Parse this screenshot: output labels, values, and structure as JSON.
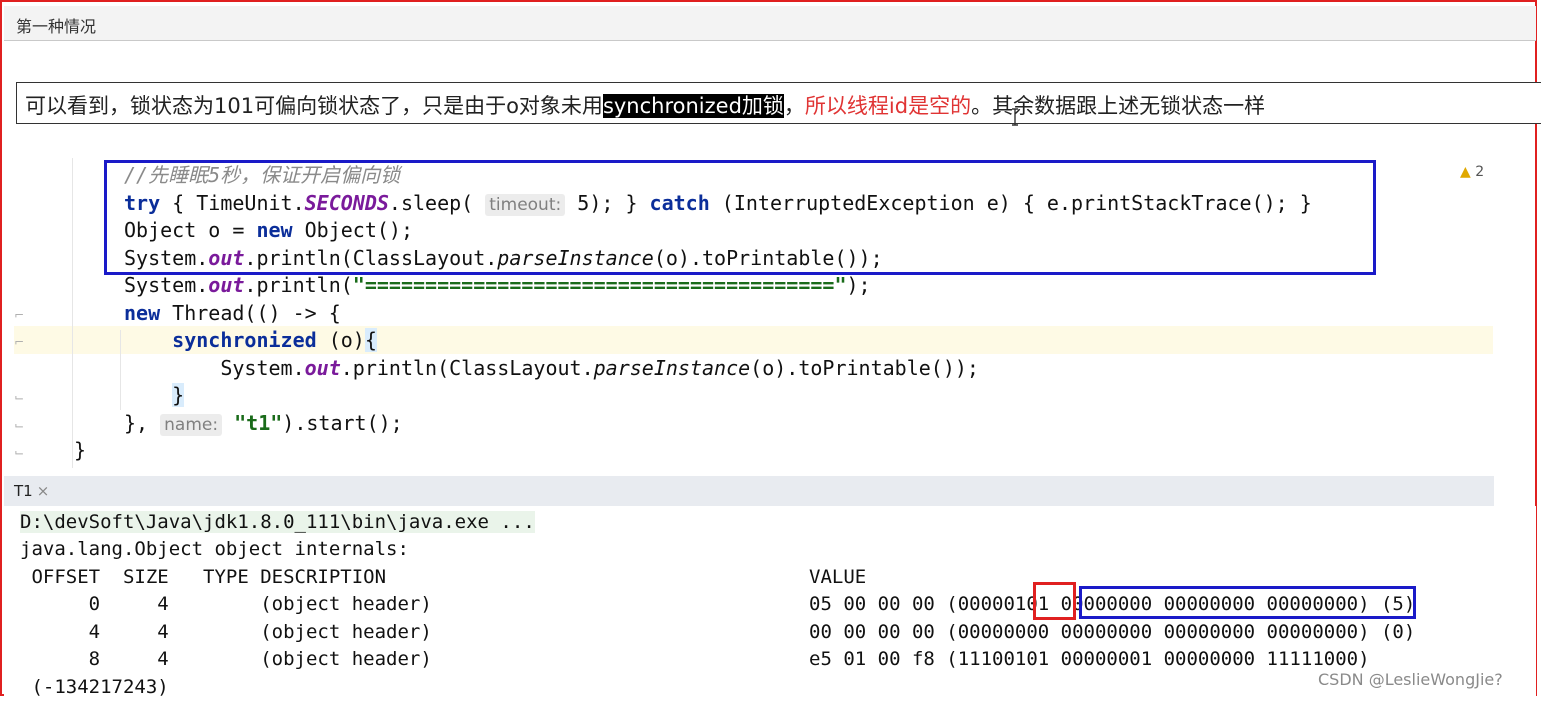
{
  "window": {
    "title": "第一种情况"
  },
  "note": {
    "part1": "可以看到，锁状态为101可偏向锁状态了，只是由于o对象未用",
    "highlight": "synchronized加锁",
    "part2": "，",
    "red": "所以线程id是空的",
    "part3": "。其余数据跟上述无锁状态一样"
  },
  "editor": {
    "warning_count": "2",
    "comment": "//先睡眠5秒，保证开启偏向锁",
    "hint_timeout": "timeout:",
    "hint_name": "name:",
    "string_equals": "\"=======================================\"",
    "string_t1": "\"t1\""
  },
  "console": {
    "tab": "T1",
    "java_path": "D:\\devSoft\\Java\\jdk1.8.0_111\\bin\\java.exe ...",
    "header_line": "java.lang.Object object internals:",
    "columns": " OFFSET  SIZE   TYPE DESCRIPTION",
    "value_header": "VALUE",
    "rows": [
      {
        "offset_size": "      0     4        (object header)",
        "value": "05 00 00 00 (00000101 00000000 00000000 00000000) (5)"
      },
      {
        "offset_size": "      4     4        (object header)",
        "value": "00 00 00 00 (00000000 00000000 00000000 00000000) (0)"
      },
      {
        "offset_size": "      8     4        (object header)",
        "value": "e5 01 00 f8 (11100101 00000001 00000000 11111000)"
      }
    ],
    "cut_line": " (-134217243)"
  },
  "watermark": "CSDN @LeslieWongJie?"
}
